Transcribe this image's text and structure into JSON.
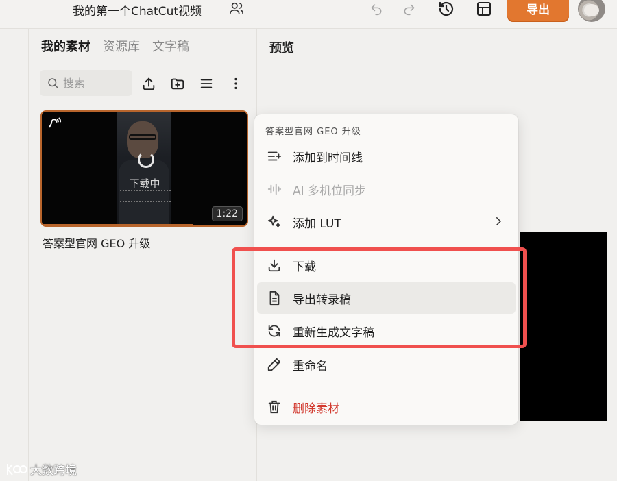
{
  "header": {
    "project_title": "我的第一个ChatCut视频",
    "export_label": "导出",
    "accent_color": "#e2772f"
  },
  "assets_panel": {
    "tabs": [
      {
        "label": "我的素材",
        "active": true
      },
      {
        "label": "资源库",
        "active": false
      },
      {
        "label": "文字稿",
        "active": false
      }
    ],
    "search_placeholder": "搜索",
    "asset": {
      "title": "答案型官网 GEO 升级",
      "duration": "1:22",
      "status": "下载中"
    }
  },
  "preview": {
    "title": "预览"
  },
  "context_menu": {
    "header": "答案型官网 GEO 升级",
    "items": [
      {
        "label": "添加到时间线",
        "icon": "add-to-timeline-icon",
        "disabled": false
      },
      {
        "label": "AI 多机位同步",
        "icon": "waveform-icon",
        "disabled": true
      },
      {
        "label": "添加 LUT",
        "icon": "sparkle-icon",
        "disabled": false,
        "has_submenu": true
      },
      {
        "label": "下载",
        "icon": "download-icon",
        "disabled": false
      },
      {
        "label": "导出转录稿",
        "icon": "document-icon",
        "disabled": false,
        "hover": true
      },
      {
        "label": "重新生成文字稿",
        "icon": "refresh-icon",
        "disabled": false
      },
      {
        "label": "重命名",
        "icon": "pencil-icon",
        "disabled": false
      },
      {
        "label": "删除素材",
        "icon": "trash-icon",
        "disabled": false,
        "danger": true
      }
    ],
    "danger_color": "#d23a2f"
  },
  "annotation": {
    "highlight_color": "#f0504e"
  },
  "watermark": {
    "text": "大数跨境"
  }
}
